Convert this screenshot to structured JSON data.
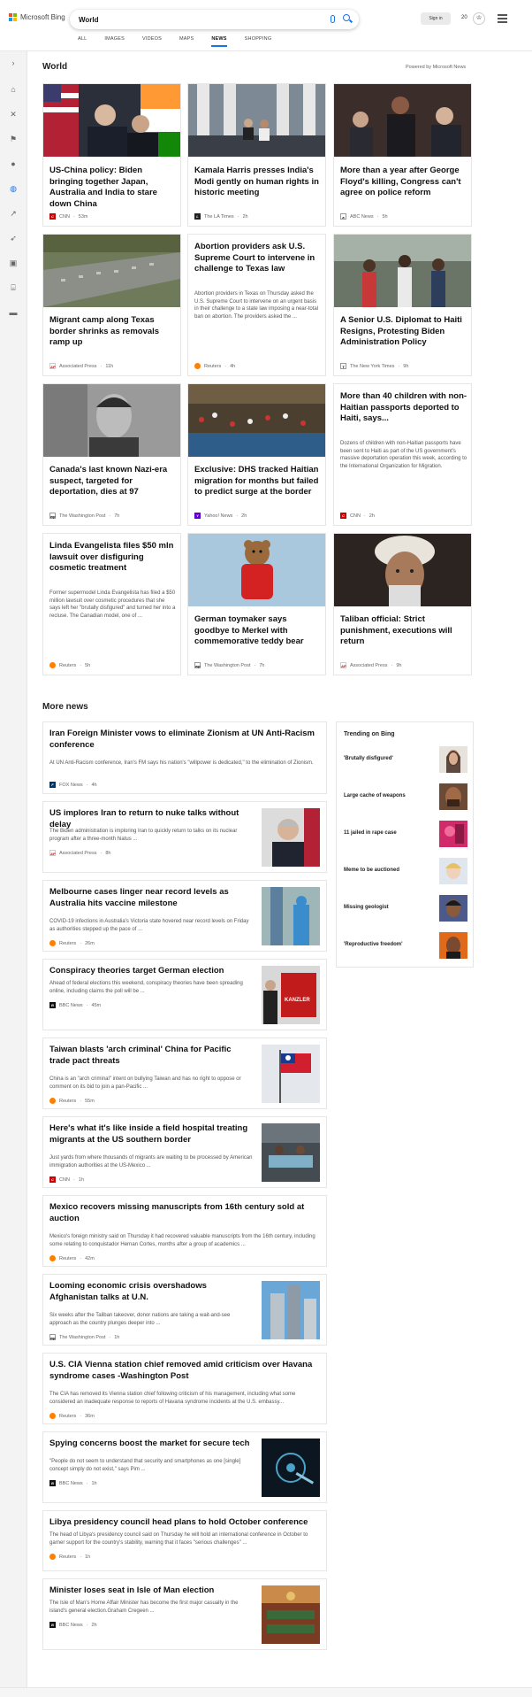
{
  "header": {
    "brand": "Microsoft Bing",
    "query": "World",
    "signin": "Sign in",
    "points": "20",
    "tabs": [
      "ALL",
      "IMAGES",
      "VIDEOS",
      "MAPS",
      "NEWS",
      "SHOPPING"
    ],
    "active_tab": "NEWS"
  },
  "world": {
    "title": "World",
    "powered": "Powered by Microsoft News",
    "cards": [
      {
        "title": "US-China policy: Biden bringing together Japan, Australia and India to stare down China",
        "source": "CNN",
        "time": "53m"
      },
      {
        "title": "Kamala Harris presses India's Modi gently on human rights in historic meeting",
        "source": "The LA Times",
        "time": "2h"
      },
      {
        "title": "More than a year after George Floyd's killing, Congress can't agree on police reform",
        "source": "ABC News",
        "time": "5h"
      },
      {
        "title": "Migrant camp along Texas border shrinks as removals ramp up",
        "source": "Associated Press",
        "time": "11h"
      },
      {
        "title": "Abortion providers ask U.S. Supreme Court to intervene in challenge to Texas law",
        "desc": "Abortion providers in Texas on Thursday asked the U.S. Supreme Court to intervene on an urgent basis in their challenge to a state law imposing a near-total ban on abortion. The providers asked the ...",
        "source": "Reuters",
        "time": "4h"
      },
      {
        "title": "A Senior U.S. Diplomat to Haiti Resigns, Protesting Biden Administration Policy",
        "source": "The New York Times",
        "time": "9h"
      },
      {
        "title": "Canada's last known Nazi-era suspect, targeted for deportation, dies at 97",
        "source": "The Washington Post",
        "time": "7h"
      },
      {
        "title": "Exclusive: DHS tracked Haitian migration for months but failed to predict surge at the border",
        "source": "Yahoo! News",
        "time": "2h"
      },
      {
        "title": "More than 40 children with non-Haitian passports deported to Haiti, says...",
        "desc": "Dozens of children with non-Haitian passports have been sent to Haiti as part of the US government's massive deportation operation this week, according to the International Organization for Migration.",
        "source": "CNN",
        "time": "2h"
      },
      {
        "title": "Linda Evangelista files $50 mln lawsuit over disfiguring cosmetic treatment",
        "desc": "Former supermodel Linda Evangelista has filed a $50 million lawsuit over cosmetic procedures that she says left her \"brutally disfigured\" and turned her into a recluse. The Canadian model, one of ...",
        "source": "Reuters",
        "time": "5h"
      },
      {
        "title": "German toymaker says goodbye to Merkel with commemorative teddy bear",
        "source": "The Washington Post",
        "time": "7h"
      },
      {
        "title": "Taliban official: Strict punishment, executions will return",
        "source": "Associated Press",
        "time": "9h"
      }
    ]
  },
  "more_news": {
    "title": "More news",
    "items": [
      {
        "title": "Iran Foreign Minister vows to eliminate Zionism at UN Anti-Racism conference",
        "desc": "At UN Anti-Racism conference, Iran's FM says his nation's \"willpower is dedicated,\" to the elimination of Zionism.",
        "source": "FOX News",
        "time": "4h"
      },
      {
        "title": "US implores Iran to return to nuke talks without delay",
        "desc": "The Biden administration is imploring Iran to quickly return to talks on its nuclear program after a three-month hiatus ...",
        "source": "Associated Press",
        "time": "8h"
      },
      {
        "title": "Melbourne cases linger near record levels as Australia hits vaccine milestone",
        "desc": "COVID-19 infections in Australia's Victoria state hovered near record levels on Friday as authorities stepped up the pace of ...",
        "source": "Reuters",
        "time": "26m"
      },
      {
        "title": "Conspiracy theories target German election",
        "desc": "Ahead of federal elections this weekend, conspiracy theories have been spreading online, including claims the poll will be ...",
        "source": "BBC News",
        "time": "45m"
      },
      {
        "title": "Taiwan blasts 'arch criminal' China for Pacific trade pact threats",
        "desc": "China is an \"arch criminal\" intent on bullying Taiwan and has no right to oppose or comment on its bid to join a pan-Pacific ...",
        "source": "Reuters",
        "time": "55m"
      },
      {
        "title": "Here's what it's like inside a field hospital treating migrants at the US southern border",
        "desc": "Just yards from where thousands of migrants are waiting to be processed by American immigration authorities at the US-Mexico ...",
        "source": "CNN",
        "time": "1h"
      },
      {
        "title": "Mexico recovers missing manuscripts from 16th century sold at auction",
        "desc": "Mexico's foreign ministry said on Thursday it had recovered valuable manuscripts from the 16th century, including some relating to conquistador Hernan Cortes, months after a group of academics ...",
        "source": "Reuters",
        "time": "42m"
      },
      {
        "title": "Looming economic crisis overshadows Afghanistan talks at U.N.",
        "desc": "Six weeks after the Taliban takeover, donor nations are taking a wait-and-see approach as the country plunges deeper into ...",
        "source": "The Washington Post",
        "time": "1h"
      },
      {
        "title": "U.S. CIA Vienna station chief removed amid criticism over Havana syndrome cases -Washington Post",
        "desc": "The CIA has removed its Vienna station chief following criticism of his management, including what some considered an inadequate response to reports of Havana syndrome incidents at the U.S. embassy...",
        "source": "Reuters",
        "time": "36m"
      },
      {
        "title": "Spying concerns boost the market for secure tech",
        "desc": "\"People do not seem to understand that security and smartphones as one [single] concept simply do not exist,\" says Pim ...",
        "source": "BBC News",
        "time": "1h"
      },
      {
        "title": "Libya presidency council head plans to hold October conference",
        "desc": "The head of Libya's presidency council said on Thursday he will hold an international conference in October to garner support for the country's stability, warning that it faces \"serious challenges\" ...",
        "source": "Reuters",
        "time": "1h"
      },
      {
        "title": "Minister loses seat in Isle of Man election",
        "desc": "The Isle of Man's Home Affair Minister has become the first major casualty in the island's general election.Graham Cregeen ...",
        "source": "BBC News",
        "time": "2h"
      }
    ]
  },
  "trending": {
    "title": "Trending on Bing",
    "items": [
      "'Brutally disfigured'",
      "Large cache of weapons",
      "11 jailed in rape case",
      "Meme to be auctioned",
      "Missing geologist",
      "'Reproductive freedom'"
    ]
  },
  "icons": {
    "search": "search-icon",
    "mic": "microphone-icon",
    "menu": "hamburger-menu-icon",
    "reward": "rewards-icon"
  }
}
